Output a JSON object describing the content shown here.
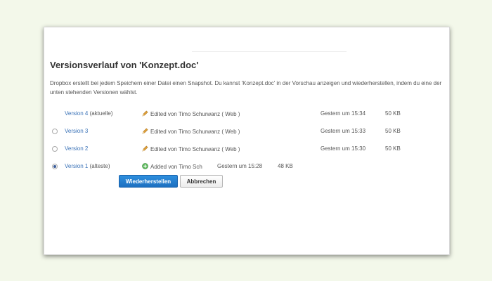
{
  "dialog": {
    "title": "Versionsverlauf von 'Konzept.doc'",
    "description": "Dropbox erstellt bei jedem Speichern einer Datei einen Snapshot. Du kannst 'Konzept.doc' in der Vorschau anzeigen und wiederherstellen, indem du eine der unten stehenden Versionen wählst."
  },
  "versions": [
    {
      "label": "Version 4",
      "suffix": " (aktuelle)",
      "action": "Edited von Timo Schurwanz ( Web )",
      "date": "Gestern um 15:34",
      "size": "50 KB",
      "icon": "pencil-icon",
      "has_radio": false,
      "selected": false
    },
    {
      "label": "Version 3",
      "suffix": "",
      "action": "Edited von Timo Schurwanz ( Web )",
      "date": "Gestern um 15:33",
      "size": "50 KB",
      "icon": "pencil-icon",
      "has_radio": true,
      "selected": false
    },
    {
      "label": "Version 2",
      "suffix": "",
      "action": "Edited von Timo Schurwanz ( Web )",
      "date": "Gestern um 15:30",
      "size": "50 KB",
      "icon": "pencil-icon",
      "has_radio": true,
      "selected": false
    },
    {
      "label": "Version 1",
      "suffix": " (alteste)",
      "action": "Added von Timo Sch",
      "date": "Gestern um 15:28",
      "size": "48 KB",
      "icon": "plus-icon",
      "has_radio": true,
      "selected": true
    }
  ],
  "buttons": {
    "restore_label": "Wiederherstellen",
    "cancel_label": "Abbrechen"
  },
  "colors": {
    "page_background": "#f3f8ea",
    "link": "#3a72b7",
    "primary_button": "#1f78cc",
    "added_icon": "#5cb85c",
    "edit_icon": "#e2a23b"
  }
}
